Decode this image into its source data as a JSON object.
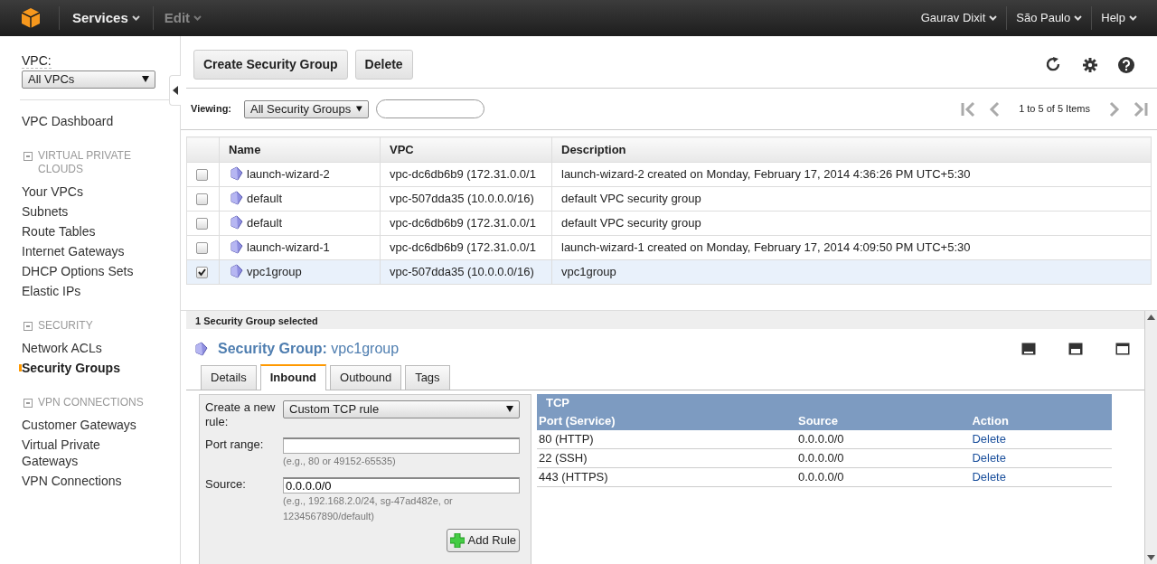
{
  "top_nav": {
    "services": "Services",
    "edit": {
      "label": "Edit",
      "disabled": true
    },
    "right_menus": [
      "Gaurav Dixit",
      "São Paulo",
      "Help"
    ]
  },
  "sidebar": {
    "vpc_label": "VPC:",
    "vpc_select": "All VPCs",
    "dashboard": "VPC Dashboard",
    "sections": [
      {
        "heading": "VIRTUAL PRIVATE CLOUDS",
        "items": [
          {
            "label": "Your VPCs",
            "selected": false
          },
          {
            "label": "Subnets",
            "selected": false
          },
          {
            "label": "Route Tables",
            "selected": false
          },
          {
            "label": "Internet Gateways",
            "selected": false
          },
          {
            "label": "DHCP Options Sets",
            "selected": false
          },
          {
            "label": "Elastic IPs",
            "selected": false
          }
        ]
      },
      {
        "heading": "SECURITY",
        "items": [
          {
            "label": "Network ACLs",
            "selected": false
          },
          {
            "label": "Security Groups",
            "selected": true
          }
        ]
      },
      {
        "heading": "VPN CONNECTIONS",
        "items": [
          {
            "label": "Customer Gateways",
            "selected": false
          },
          {
            "label": "Virtual Private Gateways",
            "selected": false
          },
          {
            "label": "VPN Connections",
            "selected": false
          }
        ]
      }
    ]
  },
  "toolbar": {
    "buttons": [
      "Create Security Group",
      "Delete"
    ]
  },
  "filter": {
    "label": "Viewing:",
    "select": "All Security Groups",
    "pager": "1 to 5 of 5 Items"
  },
  "table": {
    "columns": [
      "Name",
      "VPC",
      "Description"
    ],
    "rows": [
      {
        "checked": false,
        "name": "launch-wizard-2",
        "vpc": "vpc-dc6db6b9 (172.31.0.0/1",
        "description": "launch-wizard-2 created on Monday, February 17, 2014 4:36:26 PM UTC+5:30"
      },
      {
        "checked": false,
        "name": "default",
        "vpc": "vpc-507dda35 (10.0.0.0/16)",
        "description": "default VPC security group"
      },
      {
        "checked": false,
        "name": "default",
        "vpc": "vpc-dc6db6b9 (172.31.0.0/1",
        "description": "default VPC security group"
      },
      {
        "checked": false,
        "name": "launch-wizard-1",
        "vpc": "vpc-dc6db6b9 (172.31.0.0/1",
        "description": "launch-wizard-1 created on Monday, February 17, 2014 4:09:50 PM UTC+5:30"
      },
      {
        "checked": true,
        "name": "vpc1group",
        "vpc": "vpc-507dda35 (10.0.0.0/16)",
        "description": "vpc1group"
      }
    ]
  },
  "detail": {
    "status": "1 Security Group selected",
    "title": "**Security Group:** vpc1group",
    "tabs": [
      {
        "label": "Details",
        "selected": false
      },
      {
        "label": "Inbound",
        "selected": true
      },
      {
        "label": "Outbound",
        "selected": false
      },
      {
        "label": "Tags",
        "selected": false
      }
    ],
    "form": {
      "rule_label": "Create a new rule:",
      "rule_select": "Custom TCP rule",
      "port_label": "Port range:",
      "port_hint": "(e.g., 80 or 49152-65535)",
      "source_label": "Source:",
      "source_value": "0.0.0.0/0",
      "source_hint": "(e.g., 192.168.2.0/24, sg-47ad482e, or 1234567890/default)",
      "add_button": "Add Rule"
    },
    "rules": {
      "protocol": "TCP",
      "columns": [
        "Port (Service)",
        "Source",
        "Action"
      ],
      "rows": [
        {
          "port": "80 (HTTP)",
          "source": "0.0.0.0/0",
          "action": "Delete"
        },
        {
          "port": "22 (SSH)",
          "source": "0.0.0.0/0",
          "action": "Delete"
        },
        {
          "port": "443 (HTTPS)",
          "source": "0.0.0.0/0",
          "action": "Delete"
        }
      ]
    }
  }
}
